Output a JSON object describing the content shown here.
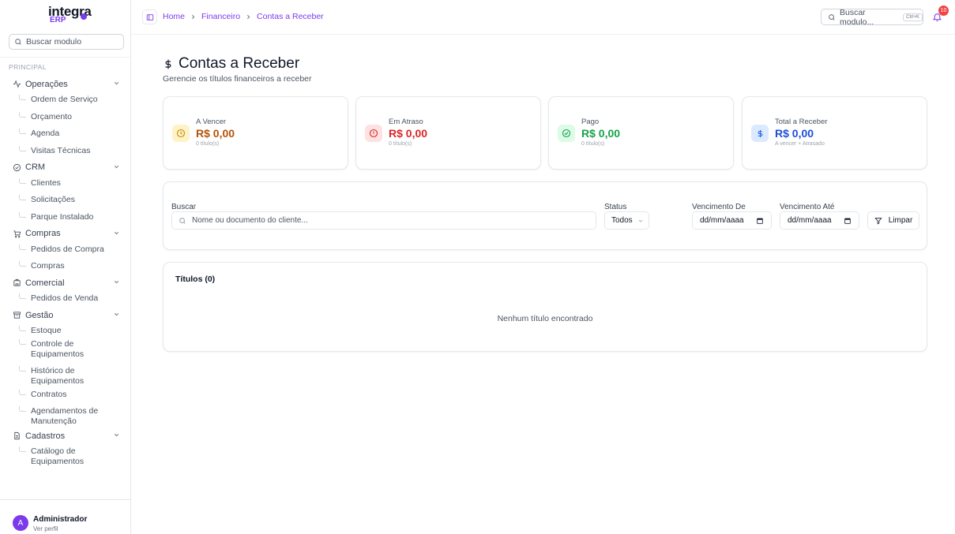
{
  "app": {
    "logo_main": "integra",
    "logo_sub": "ERP"
  },
  "sidebar": {
    "search_placeholder": "Buscar modulo",
    "section": "PRINCIPAL",
    "groups": [
      {
        "label": "Operações",
        "icon": "activity-icon",
        "items": [
          "Ordem de Serviço",
          "Orçamento",
          "Agenda",
          "Visitas Técnicas"
        ]
      },
      {
        "label": "CRM",
        "icon": "circle-check-icon",
        "items": [
          "Clientes",
          "Solicitações",
          "Parque Instalado"
        ]
      },
      {
        "label": "Compras",
        "icon": "cart-icon",
        "items": [
          "Pedidos de Compra",
          "Compras"
        ]
      },
      {
        "label": "Comercial",
        "icon": "building-icon",
        "items": [
          "Pedidos de Venda"
        ]
      },
      {
        "label": "Gestão",
        "icon": "archive-icon",
        "items": [
          "Estoque",
          "Controle de Equipamentos",
          "Histórico de Equipamentos",
          "Contratos",
          "Agendamentos de Manutenção"
        ]
      },
      {
        "label": "Cadastros",
        "icon": "file-icon",
        "items": [
          "Catálogo de Equipamentos"
        ]
      }
    ],
    "user": {
      "initial": "A",
      "name": "Administrador",
      "sub": "Ver perfil"
    }
  },
  "header": {
    "breadcrumb": [
      "Home",
      "Financeiro",
      "Contas a Receber"
    ],
    "search_label": "Buscar modulo...",
    "search_kbd": "Ctrl+K",
    "notifications": "10"
  },
  "page": {
    "title": "Contas a Receber",
    "subtitle": "Gerencie os títulos financeiros a receber"
  },
  "cards": [
    {
      "label": "A Vencer",
      "value": "R$ 0,00",
      "note": "0 título(s)",
      "color": "#b45309",
      "bg": "#fef3c7",
      "icon": "clock-icon"
    },
    {
      "label": "Em Atraso",
      "value": "R$ 0,00",
      "note": "0 título(s)",
      "color": "#dc2626",
      "bg": "#fee2e2",
      "icon": "alert-circle-icon"
    },
    {
      "label": "Pago",
      "value": "R$ 0,00",
      "note": "0 título(s)",
      "color": "#16a34a",
      "bg": "#dcfce7",
      "icon": "check-circle-icon"
    },
    {
      "label": "Total a Receber",
      "value": "R$ 0,00",
      "note": "A vencer + Atrasado",
      "color": "#1d4ed8",
      "bg": "#dbeafe",
      "icon": "dollar-icon"
    }
  ],
  "filters": {
    "search_label": "Buscar",
    "search_placeholder": "Nome ou documento do cliente...",
    "status_label": "Status",
    "status_value": "Todos",
    "from_label": "Vencimento De",
    "to_label": "Vencimento Até",
    "date_placeholder": "dd/mm/aaaa",
    "clear_label": "Limpar"
  },
  "table": {
    "title": "Títulos (0)",
    "empty": "Nenhum título encontrado"
  }
}
